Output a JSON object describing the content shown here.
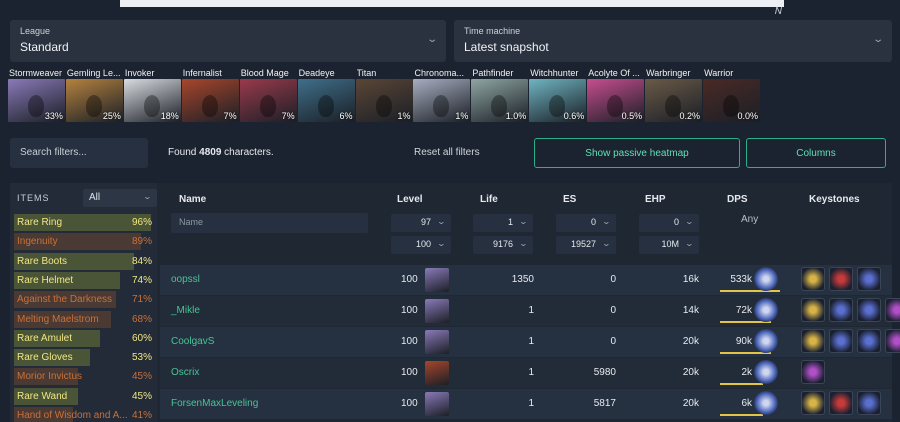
{
  "topbar": {
    "logo_glyph": "N"
  },
  "league": {
    "label": "League",
    "value": "Standard"
  },
  "time_machine": {
    "label": "Time machine",
    "value": "Latest snapshot"
  },
  "classes": [
    {
      "name": "Stormweaver",
      "pct": "33%",
      "color": "#8a7ab8"
    },
    {
      "name": "Gemling Le...",
      "pct": "25%",
      "color": "#b5823f"
    },
    {
      "name": "Invoker",
      "pct": "18%",
      "color": "#d9dde2"
    },
    {
      "name": "Infernalist",
      "pct": "7%",
      "color": "#a8462c"
    },
    {
      "name": "Blood Mage",
      "pct": "7%",
      "color": "#9a3a4c"
    },
    {
      "name": "Deadeye",
      "pct": "6%",
      "color": "#3f6f8a"
    },
    {
      "name": "Titan",
      "pct": "1%",
      "color": "#5a4636"
    },
    {
      "name": "Chronoma...",
      "pct": "1%",
      "color": "#a7aec0"
    },
    {
      "name": "Pathfinder",
      "pct": "1.0%",
      "color": "#8fa6a3"
    },
    {
      "name": "Witchhunter",
      "pct": "0.6%",
      "color": "#6fb5c2"
    },
    {
      "name": "Acolyte Of ...",
      "pct": "0.5%",
      "color": "#c74e8f"
    },
    {
      "name": "Warbringer",
      "pct": "0.2%",
      "color": "#6a5a48"
    },
    {
      "name": "Warrior",
      "pct": "0.0%",
      "color": "#4a2a25"
    }
  ],
  "search_filters": {
    "placeholder": "Search filters..."
  },
  "found": {
    "prefix": "Found",
    "count": "4809",
    "suffix": "characters."
  },
  "reset_label": "Reset all filters",
  "heatmap_label": "Show passive heatmap",
  "columns_label": "Columns",
  "items": {
    "title": "ITEMS",
    "filter_value": "All",
    "list": [
      {
        "name": "Rare Ring",
        "pct": "96%",
        "kind": "rare",
        "fill": 0.96
      },
      {
        "name": "Ingenuity",
        "pct": "89%",
        "kind": "unique",
        "fill": 0.89
      },
      {
        "name": "Rare Boots",
        "pct": "84%",
        "kind": "rare",
        "fill": 0.84
      },
      {
        "name": "Rare Helmet",
        "pct": "74%",
        "kind": "rare",
        "fill": 0.74
      },
      {
        "name": "Against the Darkness",
        "pct": "71%",
        "kind": "unique",
        "fill": 0.71
      },
      {
        "name": "Melting Maelstrom",
        "pct": "68%",
        "kind": "unique",
        "fill": 0.68
      },
      {
        "name": "Rare Amulet",
        "pct": "60%",
        "kind": "rare",
        "fill": 0.6
      },
      {
        "name": "Rare Gloves",
        "pct": "53%",
        "kind": "rare",
        "fill": 0.53
      },
      {
        "name": "Morior Invictus",
        "pct": "45%",
        "kind": "unique",
        "fill": 0.45
      },
      {
        "name": "Rare Wand",
        "pct": "45%",
        "kind": "rare",
        "fill": 0.45
      },
      {
        "name": "Hand of Wisdom and A...",
        "pct": "41%",
        "kind": "unique",
        "fill": 0.41
      }
    ]
  },
  "table": {
    "headers": {
      "name": "Name",
      "level": "Level",
      "life": "Life",
      "es": "ES",
      "ehp": "EHP",
      "dps": "DPS",
      "keystones": "Keystones"
    },
    "name_placeholder": "Name",
    "filters": {
      "level_min": "97",
      "level_max": "100",
      "life_min": "1",
      "life_max": "9176",
      "es_min": "0",
      "es_max": "19527",
      "ehp_min": "0",
      "ehp_max": "10M",
      "dps": "Any"
    },
    "rows": [
      {
        "name": "oopssl",
        "level": "100",
        "life": "1350",
        "es": "0",
        "ehp": "16k",
        "dps": "533k",
        "dps_fill": 1.0,
        "avatar": "#8a7ab8",
        "keystones": [
          "#d8b447",
          "#c73a3a",
          "#5a6fd0"
        ]
      },
      {
        "name": "_Mikle",
        "level": "100",
        "life": "1",
        "es": "0",
        "ehp": "14k",
        "dps": "72k",
        "dps_fill": 0.85,
        "avatar": "#8a7ab8",
        "keystones": [
          "#d8b447",
          "#5a6fd0",
          "#5a6fd0",
          "#b04fc7"
        ]
      },
      {
        "name": "CoolgavS",
        "level": "100",
        "life": "1",
        "es": "0",
        "ehp": "20k",
        "dps": "90k",
        "dps_fill": 0.85,
        "avatar": "#8a7ab8",
        "keystones": [
          "#d8b447",
          "#5a6fd0",
          "#5a6fd0",
          "#b04fc7"
        ]
      },
      {
        "name": "Oscrix",
        "level": "100",
        "life": "1",
        "es": "5980",
        "ehp": "20k",
        "dps": "2k",
        "dps_fill": 0.72,
        "avatar": "#a8462c",
        "keystones": [
          "#b04fc7"
        ]
      },
      {
        "name": "ForsenMaxLeveling",
        "level": "100",
        "life": "1",
        "es": "5817",
        "ehp": "20k",
        "dps": "6k",
        "dps_fill": 0.72,
        "avatar": "#8a7ab8",
        "keystones": [
          "#d8b447",
          "#c73a3a",
          "#5a6fd0"
        ]
      }
    ]
  }
}
